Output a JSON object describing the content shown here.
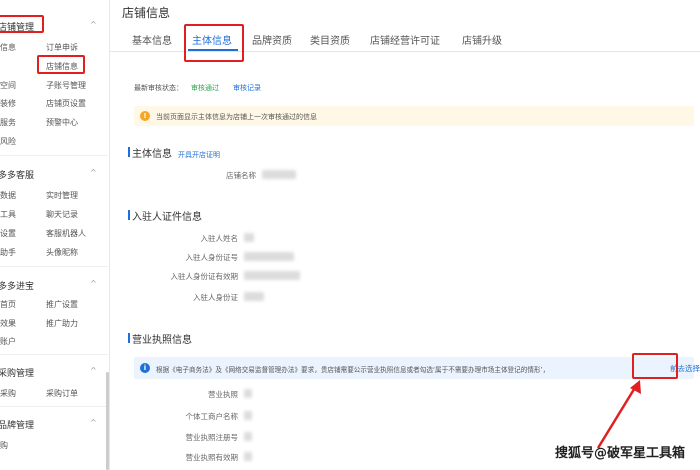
{
  "sidebar": {
    "sections": [
      {
        "title": "店铺管理",
        "items": [
          [
            "信息",
            "订单申诉"
          ],
          [
            "",
            "店铺信息"
          ],
          [
            "空间",
            "子账号管理"
          ],
          [
            "装修",
            "店铺页设置"
          ],
          [
            "服务",
            "预警中心"
          ],
          [
            "风险",
            ""
          ]
        ]
      },
      {
        "title": "多多客服",
        "items": [
          [
            "数据",
            "实时管理"
          ],
          [
            "工具",
            "聊天记录"
          ],
          [
            "设置",
            "客服机器人"
          ],
          [
            "助手",
            "头像昵称"
          ]
        ]
      },
      {
        "title": "多多进宝",
        "items": [
          [
            "首页",
            "推广设置"
          ],
          [
            "效果",
            "推广助力"
          ],
          [
            "账户",
            ""
          ]
        ]
      },
      {
        "title": "采购管理",
        "items": [
          [
            "采购",
            "采购订单"
          ]
        ]
      },
      {
        "title": "品牌管理",
        "items": [
          [
            "购",
            ""
          ]
        ]
      }
    ],
    "caret": "^"
  },
  "main": {
    "page_title": "店铺信息",
    "tabs": [
      "基本信息",
      "主体信息",
      "品牌资质",
      "类目资质",
      "店铺经营许可证",
      "店铺升级"
    ],
    "active_tab": "主体信息",
    "status": {
      "label": "最新审核状态：",
      "value": "审核通过",
      "record_link": "审核记录"
    },
    "warning": {
      "icon": "!",
      "text": "当前页面显示主体信息为店铺上一次审核通过的信息"
    },
    "subject": {
      "title": "主体信息",
      "link": "开具开店证明",
      "fields": [
        "店铺名称"
      ]
    },
    "id_info": {
      "title": "入驻人证件信息",
      "fields": [
        "入驻人姓名",
        "入驻人身份证号",
        "入驻人身份证有效期",
        "入驻人身份证"
      ]
    },
    "license": {
      "title": "营业执照信息",
      "notice_icon": "i",
      "notice_text": "根据《电子商务法》及《网络交易监督管理办法》要求，贵店铺需要公示营业执照信息或者勾选‘属于不需要办理市场主体登记的情形’，",
      "notice_link": "前去选择",
      "fields": [
        "营业执照",
        "个体工商户名称",
        "营业执照注册号",
        "营业执照有效期"
      ]
    }
  },
  "watermark": "搜狐号@破军星工具箱",
  "colors": {
    "accent": "#1e6fd8",
    "highlight": "#e02020",
    "success": "#2ea44f",
    "warning_bg": "#fff8e6",
    "info_bg": "#eaf3fe"
  }
}
